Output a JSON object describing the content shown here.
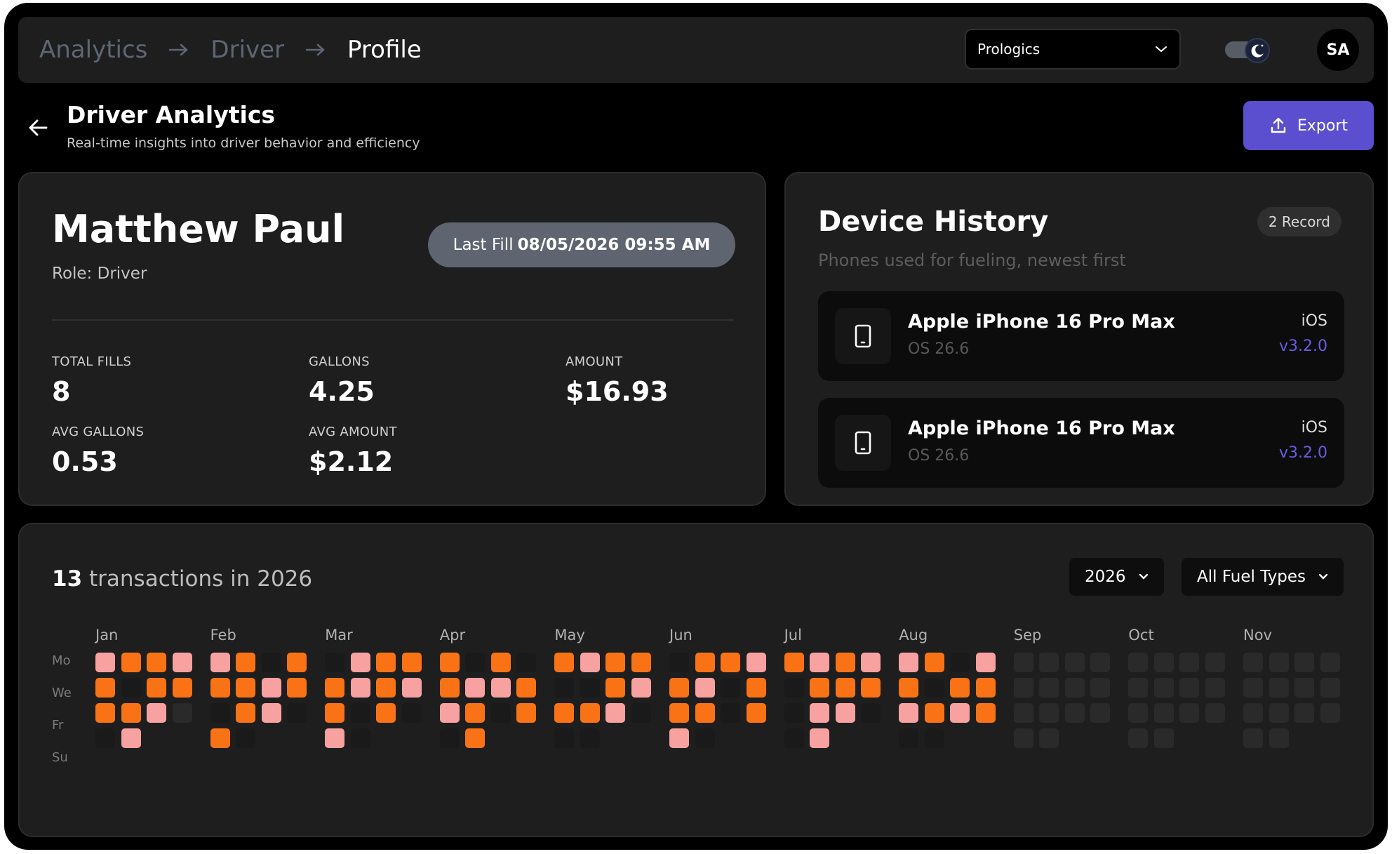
{
  "breadcrumb": [
    "Analytics",
    "Driver",
    "Profile"
  ],
  "org": {
    "selected": "Prologics"
  },
  "user": {
    "initials": "SA"
  },
  "header": {
    "title": "Driver Analytics",
    "subtitle": "Real-time insights into driver behavior and efficiency",
    "export_label": "Export"
  },
  "profile": {
    "name": "Matthew Paul",
    "role": "Role: Driver",
    "last_fill_label": "Last Fill",
    "last_fill_value": "08/05/2026 09:55 AM",
    "stats": [
      {
        "label": "TOTAL FILLS",
        "value": "8"
      },
      {
        "label": "GALLONS",
        "value": "4.25"
      },
      {
        "label": "AMOUNT",
        "value": "$16.93"
      },
      {
        "label": "AVG GALLONS",
        "value": "0.53"
      },
      {
        "label": "AVG AMOUNT",
        "value": "$2.12"
      }
    ]
  },
  "devices": {
    "title": "Device History",
    "badge": "2 Record",
    "subtitle": "Phones used for fueling, newest first",
    "items": [
      {
        "name": "Apple iPhone 16 Pro Max",
        "os": "OS 26.6",
        "platform": "iOS",
        "version": "v3.2.0"
      },
      {
        "name": "Apple iPhone 16 Pro Max",
        "os": "OS 26.6",
        "platform": "iOS",
        "version": "v3.2.0"
      }
    ]
  },
  "calendar": {
    "count": "13",
    "title_rest": "transactions in 2026",
    "year_select": "2026",
    "fuel_select": "All Fuel Types",
    "day_labels": [
      "Mo",
      "We",
      "Fr",
      "Su"
    ],
    "colors": {
      "empty": "#2a2a2a",
      "dark": "#1a1a1a",
      "light": "#f8a1a1",
      "strong": "#f97316"
    },
    "months": [
      {
        "name": "Jan",
        "grid": [
          "LSSL",
          "SDSS",
          "SSLE",
          "DL"
        ]
      },
      {
        "name": "Feb",
        "grid": [
          "LSDS",
          "SSLS",
          "DSLD",
          "SD"
        ]
      },
      {
        "name": "Mar",
        "grid": [
          "DLSS",
          "SLSL",
          "SDSD",
          "LD"
        ]
      },
      {
        "name": "Apr",
        "grid": [
          "SDSD",
          "SLLS",
          "LSDS",
          "DS"
        ]
      },
      {
        "name": "May",
        "grid": [
          "SLSS",
          "DDSL",
          "SSLD",
          "DD"
        ]
      },
      {
        "name": "Jun",
        "grid": [
          "DSSL",
          "SLDS",
          "SSDS",
          "LD"
        ]
      },
      {
        "name": "Jul",
        "grid": [
          "SLSL",
          "DSSS",
          "DLLD",
          "DL"
        ]
      },
      {
        "name": "Aug",
        "grid": [
          "LSDL",
          "SDSS",
          "LSLS",
          "DD"
        ]
      },
      {
        "name": "Sep",
        "grid": [
          "EEEE",
          "EEEE",
          "EEEE",
          "EE"
        ]
      },
      {
        "name": "Oct",
        "grid": [
          "EEEE",
          "EEEE",
          "EEEE",
          "EE"
        ]
      },
      {
        "name": "Nov",
        "grid": [
          "EEEE",
          "EEEE",
          "EEEE",
          "EE"
        ]
      }
    ]
  }
}
